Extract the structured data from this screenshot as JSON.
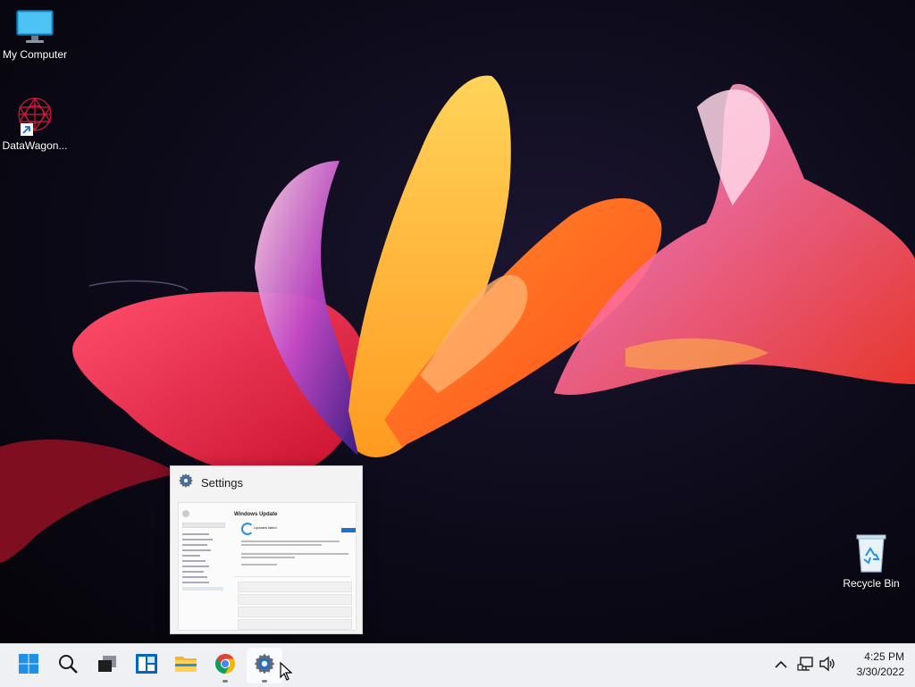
{
  "desktop": {
    "icons": [
      {
        "label": "My Computer",
        "icon": "monitor-icon"
      },
      {
        "label": "DataWagon...",
        "icon": "datawagon-shortcut-icon"
      },
      {
        "label": "Recycle Bin",
        "icon": "recycle-bin-icon"
      }
    ]
  },
  "preview": {
    "title": "Settings",
    "icon": "gear-icon",
    "content": {
      "heading": "Windows Update",
      "status": "Updates failed"
    }
  },
  "taskbar": {
    "apps": [
      {
        "name": "Start",
        "icon": "windows-start-icon"
      },
      {
        "name": "Search",
        "icon": "search-icon"
      },
      {
        "name": "Task View",
        "icon": "task-view-icon"
      },
      {
        "name": "Widgets",
        "icon": "widgets-icon"
      },
      {
        "name": "File Explorer",
        "icon": "folder-icon"
      },
      {
        "name": "Google Chrome",
        "icon": "chrome-icon"
      },
      {
        "name": "Settings",
        "icon": "gear-icon"
      }
    ],
    "tray": {
      "time": "4:25 PM",
      "date": "3/30/2022",
      "icons": [
        "chevron-up-icon",
        "network-icon",
        "volume-icon"
      ]
    }
  },
  "colors": {
    "taskbar_bg": "#eef0f4",
    "accent": "#0067c0",
    "start_blue": "#1e90e8"
  }
}
